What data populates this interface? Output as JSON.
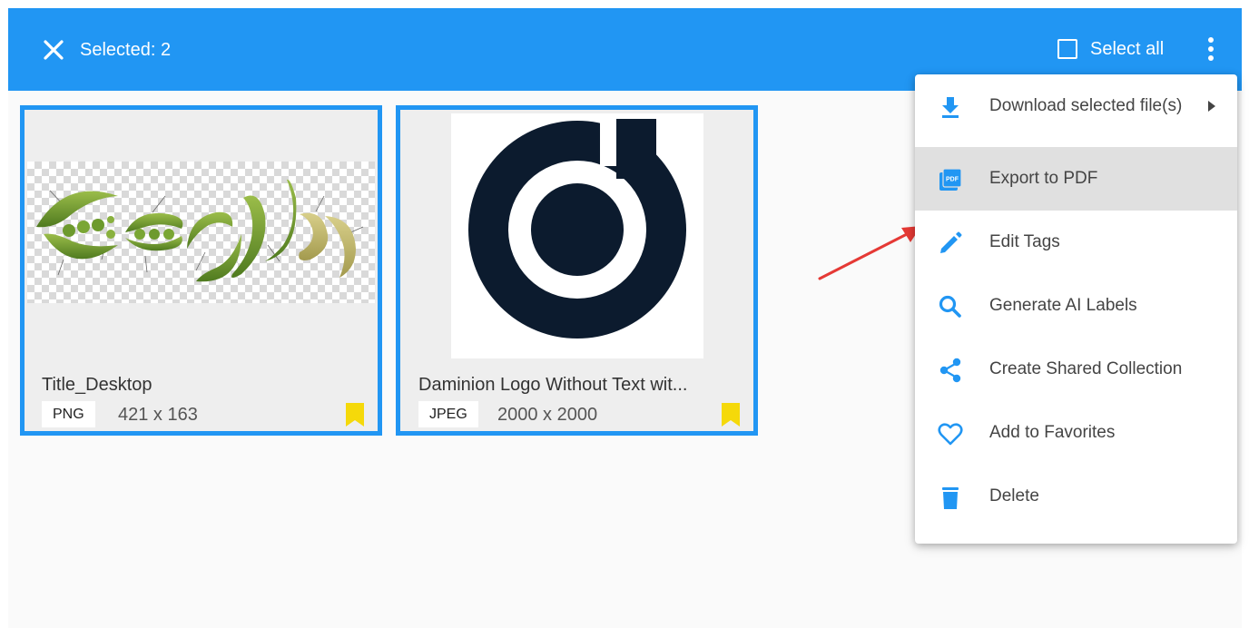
{
  "toolbar": {
    "selected_text": "Selected: 2",
    "select_all_label": "Select all",
    "select_all_checked": false,
    "bar_color": "#2196f3"
  },
  "files": [
    {
      "title": "Title_Desktop",
      "type": "PNG",
      "dimensions": "421 x 163",
      "bookmarked": true,
      "selected": true
    },
    {
      "title": "Daminion Logo Without Text wit...",
      "type": "JPEG",
      "dimensions": "2000 x 2000",
      "bookmarked": true,
      "selected": true
    }
  ],
  "menu": {
    "items": [
      {
        "label": "Download selected file(s)",
        "icon": "download-icon",
        "has_submenu": true
      },
      {
        "label": "Export to PDF",
        "icon": "pdf-icon",
        "highlighted": true
      },
      {
        "label": "Edit Tags",
        "icon": "pencil-icon"
      },
      {
        "label": "Generate AI Labels",
        "icon": "search-icon"
      },
      {
        "label": "Create Shared Collection",
        "icon": "share-icon"
      },
      {
        "label": "Add to Favorites",
        "icon": "heart-icon"
      },
      {
        "label": "Delete",
        "icon": "trash-icon"
      }
    ]
  },
  "colors": {
    "accent": "#2196f3",
    "bookmark": "#f5d90a",
    "annotation_arrow": "#e53935",
    "logo_dark": "#0c1b2e"
  }
}
